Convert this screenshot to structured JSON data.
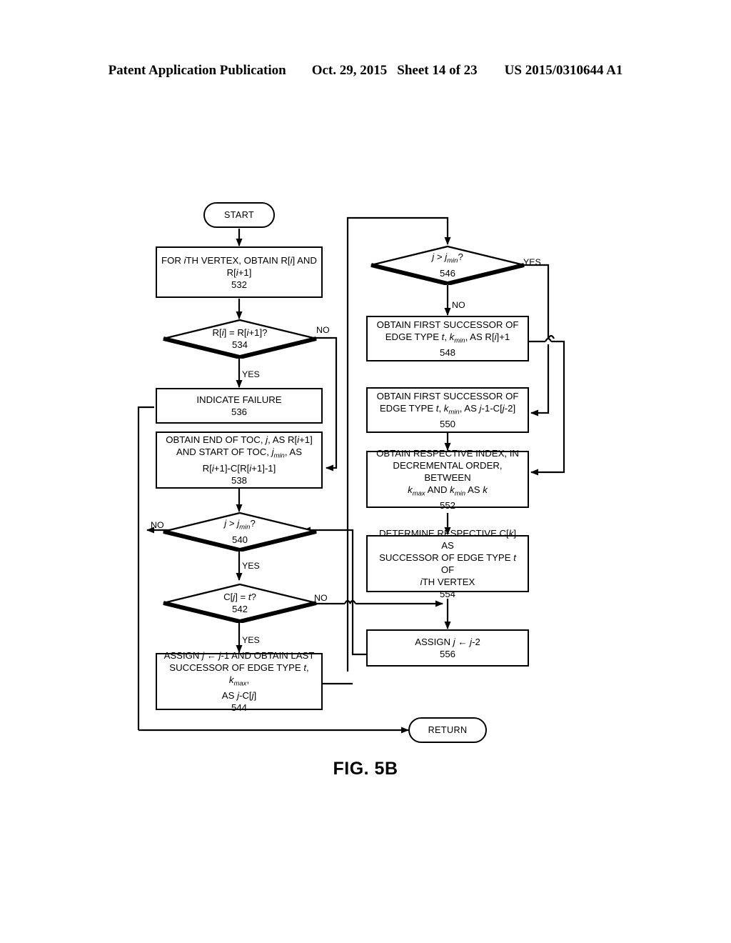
{
  "header": {
    "publication": "Patent Application Publication",
    "date": "Oct. 29, 2015",
    "sheet": "Sheet 14 of 23",
    "number": "US 2015/0310644 A1"
  },
  "figure": {
    "caption": "FIG. 5B"
  },
  "colors": {
    "ink": "#000000",
    "paper": "#ffffff"
  },
  "flowchart": {
    "terminals": [
      {
        "id": "start",
        "label": "START"
      },
      {
        "id": "return",
        "label": "RETURN"
      }
    ],
    "nodes": [
      {
        "id": "n532",
        "type": "process",
        "ref": "532",
        "lines": [
          "FOR iTH VERTEX, OBTAIN R[i] AND",
          "R[i+1]"
        ],
        "text": "FOR iTH VERTEX, OBTAIN R[i] AND R[i+1] 532"
      },
      {
        "id": "n534",
        "type": "decision",
        "ref": "534",
        "lines": [
          "R[i] = R[i+1]?"
        ],
        "text": "R[i] = R[i+1]? 534"
      },
      {
        "id": "n536",
        "type": "process",
        "ref": "536",
        "lines": [
          "INDICATE FAILURE"
        ],
        "text": "INDICATE FAILURE 536"
      },
      {
        "id": "n538",
        "type": "process",
        "ref": "538",
        "lines": [
          "OBTAIN END OF TOC, j, AS R[i+1]",
          "AND START OF TOC, jmin, AS",
          "R[i+1]-C[R[i+1]-1]"
        ],
        "text": "OBTAIN END OF TOC, j, AS R[i+1] AND START OF TOC, jmin, AS R[i+1]-C[R[i+1]-1] 538"
      },
      {
        "id": "n540",
        "type": "decision",
        "ref": "540",
        "lines": [
          "j > jmin?"
        ],
        "text": "j > jmin? 540"
      },
      {
        "id": "n542",
        "type": "decision",
        "ref": "542",
        "lines": [
          "C[j] = t?"
        ],
        "text": "C[j] = t? 542"
      },
      {
        "id": "n544",
        "type": "process",
        "ref": "544",
        "lines": [
          "ASSIGN j ← j-1 AND OBTAIN LAST",
          "SUCCESSOR OF EDGE TYPE t, kmax,",
          "AS j-C[j]"
        ],
        "text": "ASSIGN j <- j-1 AND OBTAIN LAST SUCCESSOR OF EDGE TYPE t, kmax, AS j-C[j] 544"
      },
      {
        "id": "n546",
        "type": "decision",
        "ref": "546",
        "lines": [
          "j > jmin?"
        ],
        "text": "j > jmin? 546"
      },
      {
        "id": "n548",
        "type": "process",
        "ref": "548",
        "lines": [
          "OBTAIN FIRST SUCCESSOR OF",
          "EDGE TYPE t, kmin, AS R[i]+1"
        ],
        "text": "OBTAIN FIRST SUCCESSOR OF EDGE TYPE t, kmin, AS R[i]+1 548"
      },
      {
        "id": "n550",
        "type": "process",
        "ref": "550",
        "lines": [
          "OBTAIN FIRST SUCCESSOR OF",
          "EDGE TYPE t, kmin, AS j-1-C[j-2]"
        ],
        "text": "OBTAIN FIRST SUCCESSOR OF EDGE TYPE t, kmin, AS j-1-C[j-2] 550"
      },
      {
        "id": "n552",
        "type": "process",
        "ref": "552",
        "lines": [
          "OBTAIN RESPECTIVE INDEX, IN",
          "DECREMENTAL ORDER, BETWEEN",
          "kmax AND kmin AS k"
        ],
        "text": "OBTAIN RESPECTIVE INDEX, IN DECREMENTAL ORDER, BETWEEN kmax AND kmin AS k 552"
      },
      {
        "id": "n554",
        "type": "process",
        "ref": "554",
        "lines": [
          "DETERMINE RESPECTIVE C[k] AS",
          "SUCCESSOR OF EDGE TYPE t OF",
          "iTH VERTEX"
        ],
        "text": "DETERMINE RESPECTIVE C[k] AS SUCCESSOR OF EDGE TYPE t OF iTH VERTEX 554"
      },
      {
        "id": "n556",
        "type": "process",
        "ref": "556",
        "lines": [
          "ASSIGN j ← j-2"
        ],
        "text": "ASSIGN j <- j-2 556"
      }
    ],
    "edge_labels": [
      {
        "id": "e534-no",
        "text": "NO",
        "from": "n534",
        "to": "n538"
      },
      {
        "id": "e534-yes",
        "text": "YES",
        "from": "n534",
        "to": "n536"
      },
      {
        "id": "e540-no",
        "text": "NO",
        "from": "n540",
        "to": "return"
      },
      {
        "id": "e540-yes",
        "text": "YES",
        "from": "n540",
        "to": "n542"
      },
      {
        "id": "e542-no",
        "text": "NO",
        "from": "n542",
        "to": "n556"
      },
      {
        "id": "e542-yes",
        "text": "YES",
        "from": "n542",
        "to": "n544"
      },
      {
        "id": "e546-yes",
        "text": "YES",
        "from": "n546",
        "to": "n550"
      },
      {
        "id": "e546-no",
        "text": "NO",
        "from": "n546",
        "to": "n548"
      }
    ]
  }
}
